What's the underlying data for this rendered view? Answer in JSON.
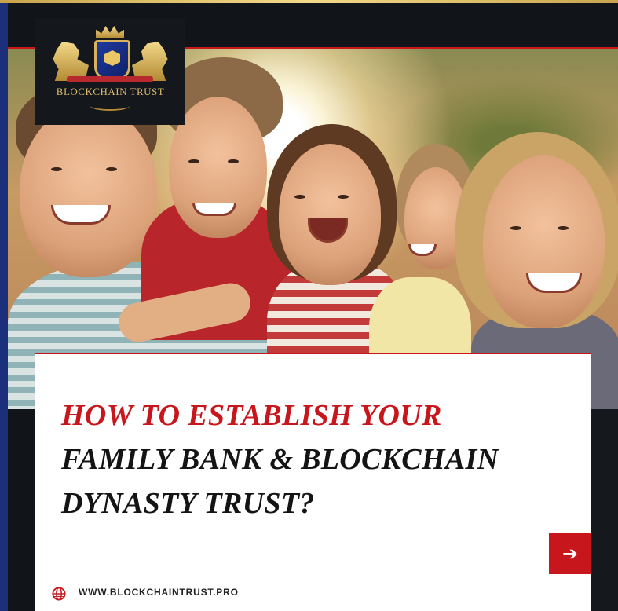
{
  "logo": {
    "text": "BLOCKCHAIN TRUST"
  },
  "headline": {
    "line1": "HOW TO ESTABLISH YOUR",
    "line2": "FAMILY BANK & BLOCKCHAIN",
    "line3": "DYNASTY TRUST?"
  },
  "cta": {
    "arrow": "➔",
    "icon": "arrow-right-icon"
  },
  "footer": {
    "url": "WWW.BLOCKCHAINTRUST.PRO",
    "icon": "globe-icon"
  },
  "colors": {
    "accent_red": "#c8161d",
    "gold": "#d9bb6a",
    "brand_blue": "#1b2f7a",
    "text_dark": "#141414"
  }
}
